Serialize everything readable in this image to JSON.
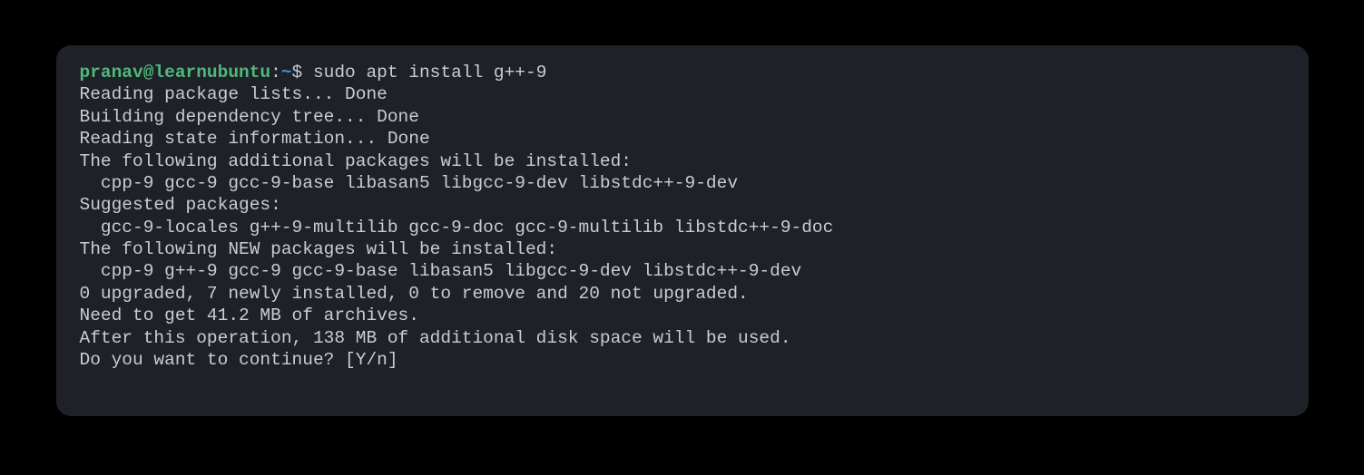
{
  "terminal": {
    "prompt": {
      "user_host": "pranav@learnubuntu",
      "separator": ":",
      "path": "~",
      "symbol": "$"
    },
    "command": " sudo apt install g++-9",
    "output": {
      "l0": "Reading package lists... Done",
      "l1": "Building dependency tree... Done",
      "l2": "Reading state information... Done",
      "l3": "The following additional packages will be installed:",
      "l4": "  cpp-9 gcc-9 gcc-9-base libasan5 libgcc-9-dev libstdc++-9-dev",
      "l5": "Suggested packages:",
      "l6": "  gcc-9-locales g++-9-multilib gcc-9-doc gcc-9-multilib libstdc++-9-doc",
      "l7": "The following NEW packages will be installed:",
      "l8": "  cpp-9 g++-9 gcc-9 gcc-9-base libasan5 libgcc-9-dev libstdc++-9-dev",
      "l9": "0 upgraded, 7 newly installed, 0 to remove and 20 not upgraded.",
      "l10": "Need to get 41.2 MB of archives.",
      "l11": "After this operation, 138 MB of additional disk space will be used.",
      "l12": "Do you want to continue? [Y/n]"
    }
  }
}
